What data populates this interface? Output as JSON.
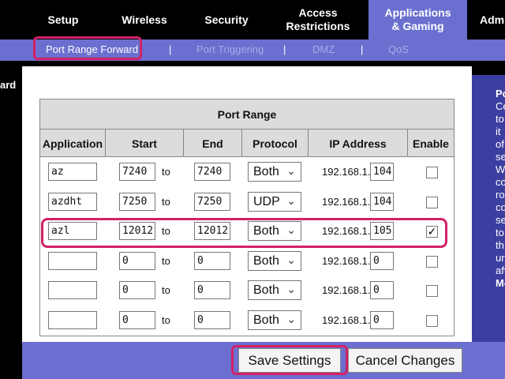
{
  "top_nav": {
    "tabs": [
      {
        "label": "Setup"
      },
      {
        "label": "Wireless"
      },
      {
        "label": "Security"
      },
      {
        "label": "Access Restrictions"
      },
      {
        "label_line1": "Applications",
        "label_line2": "& Gaming",
        "active": true
      },
      {
        "label": "Adm"
      }
    ]
  },
  "sub_nav": {
    "items": [
      {
        "label": "Port Range Forward",
        "active": true
      },
      {
        "label": "Port Triggering"
      },
      {
        "label": "DMZ"
      },
      {
        "label": "QoS"
      }
    ],
    "separator": "|"
  },
  "left_label": "ard",
  "table": {
    "group_header": "Port Range",
    "columns": [
      "Application",
      "Start",
      "End",
      "Protocol",
      "IP Address",
      "Enable"
    ],
    "to_label": "to",
    "ip_prefix": "192.168.1.",
    "rows": [
      {
        "application": "az",
        "start": "7240",
        "end": "7240",
        "protocol": "Both",
        "ip_last": "104",
        "enabled": false
      },
      {
        "application": "azdht",
        "start": "7250",
        "end": "7250",
        "protocol": "UDP",
        "ip_last": "104",
        "enabled": false
      },
      {
        "application": "azl",
        "start": "12012",
        "end": "12012",
        "protocol": "Both",
        "ip_last": "105",
        "enabled": true
      },
      {
        "application": "",
        "start": "0",
        "end": "0",
        "protocol": "Both",
        "ip_last": "0",
        "enabled": false
      },
      {
        "application": "",
        "start": "0",
        "end": "0",
        "protocol": "Both",
        "ip_last": "0",
        "enabled": false
      },
      {
        "application": "",
        "start": "0",
        "end": "0",
        "protocol": "Both",
        "ip_last": "0",
        "enabled": false
      }
    ]
  },
  "help_panel": {
    "lines": [
      "Po",
      "Ce",
      "to",
      "it",
      "of",
      "se",
      "W",
      "co",
      "ro",
      "co",
      "se",
      "to",
      "th",
      "ur",
      "aft",
      "Mo"
    ]
  },
  "buttons": {
    "save": "Save Settings",
    "cancel": "Cancel Changes"
  },
  "colors": {
    "nav_active": "#6b6fcf",
    "help_panel": "#3c3ea0",
    "highlight": "#d32166"
  }
}
